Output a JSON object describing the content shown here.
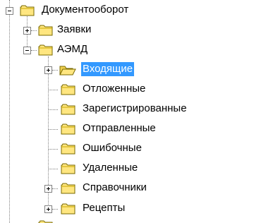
{
  "tree": {
    "root": {
      "label": "Документооборот",
      "expanded": true
    },
    "level1": [
      {
        "label": "Заявки",
        "expanded": false
      },
      {
        "label": "АЭМД",
        "expanded": true
      }
    ],
    "aemd_children": [
      {
        "label": "Входящие",
        "selected": true,
        "has_children": true,
        "folder": "open"
      },
      {
        "label": "Отложенные",
        "selected": false,
        "has_children": false,
        "folder": "closed"
      },
      {
        "label": "Зарегистрированные",
        "selected": false,
        "has_children": false,
        "folder": "closed"
      },
      {
        "label": "Отправленные",
        "selected": false,
        "has_children": false,
        "folder": "closed"
      },
      {
        "label": "Ошибочные",
        "selected": false,
        "has_children": false,
        "folder": "closed"
      },
      {
        "label": "Удаленные",
        "selected": false,
        "has_children": false,
        "folder": "closed"
      },
      {
        "label": "Справочники",
        "selected": false,
        "has_children": true,
        "folder": "closed"
      },
      {
        "label": "Рецепты",
        "selected": false,
        "has_children": true,
        "folder": "closed"
      }
    ]
  },
  "colors": {
    "selection_bg": "#3399ff",
    "folder_fill": "#ffe680",
    "folder_stroke": "#7a6a00",
    "tree_lines": "#808080"
  },
  "icons": {
    "expander_expanded": "minus-box-icon",
    "expander_collapsed": "plus-box-icon",
    "folder_closed": "folder-icon",
    "folder_open": "folder-open-icon"
  }
}
